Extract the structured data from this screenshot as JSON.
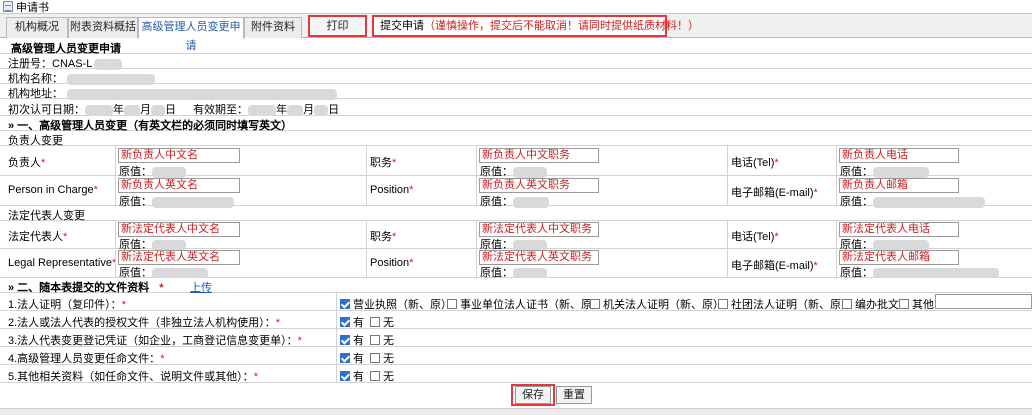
{
  "window": {
    "title": "申请书"
  },
  "tabs": [
    {
      "label": "机构概况"
    },
    {
      "label": "附表资料概括"
    },
    {
      "label": "高级管理人员变更申请"
    },
    {
      "label": "附件资料"
    }
  ],
  "toolbar": {
    "print_label": "打印",
    "submit_label": "提交申请",
    "submit_warning": "（谨慎操作，提交后不能取消！请同时提供纸质材料！）"
  },
  "form": {
    "title": "高级管理人员变更申请",
    "reg_no_label": "注册号：",
    "reg_no_value": "CNAS-L",
    "org_name_label": "机构名称：",
    "org_addr_label": "机构地址：",
    "first_date_label": "初次认可日期：",
    "valid_until_label": "有效期至：",
    "year": "年",
    "month": "月",
    "day": "日",
    "section1_title": "» 一、高级管理人员变更（有英文栏的必须同时填写英文）",
    "owner_change_label": "负责人变更",
    "legal_change_label": "法定代表人变更",
    "original_prefix": "原值：",
    "rows": [
      {
        "l1": "负责人",
        "p1": "新负责人中文名",
        "l2": "职务",
        "p2": "新负责人中文职务",
        "l3": "电话(Tel)",
        "p3": "新负责人电话"
      },
      {
        "l1": "Person in Charge",
        "p1": "新负责人英文名",
        "l2": "Position",
        "p2": "新负责人英文职务",
        "l3": "电子邮箱(E-mail)",
        "p3": "新负责人邮箱"
      },
      {
        "l1": "法定代表人",
        "p1": "新法定代表人中文名",
        "l2": "职务",
        "p2": "新法定代表人中文职务",
        "l3": "电话(Tel)",
        "p3": "新法定代表人电话"
      },
      {
        "l1": "Legal Representative",
        "p1": "新法定代表人英文名",
        "l2": "Position",
        "p2": "新法定代表人英文职务",
        "l3": "电子邮箱(E-mail)",
        "p3": "新法定代表人邮箱"
      }
    ],
    "section2_title": "» 二、随本表提交的文件资料",
    "upload_label": "上传",
    "docs": [
      {
        "label": "1.法人证明（复印件）："
      },
      {
        "label": "2.法人或法人代表的授权文件（非独立法人机构使用）："
      },
      {
        "label": "3.法人代表变更登记凭证（如企业，工商登记信息变更单）："
      },
      {
        "label": "4.高级管理人员变更任命文件："
      },
      {
        "label": "5.其他相关资料（如任命文件、说明文件或其他）："
      }
    ],
    "doc1_options": [
      "营业执照（新、原）",
      "事业单位法人证书（新、原）",
      "机关法人证明（新、原）",
      "社团法人证明（新、原）",
      "编办批文",
      "其他"
    ],
    "yes_label": "有",
    "no_label": "无",
    "required_mark": "*",
    "save_label": "保存",
    "reset_label": "重置"
  },
  "colors": {
    "accent_red": "#e0393c",
    "required_red": "#d11d1d",
    "link_blue": "#1a55b8",
    "check_blue": "#2c6fd6"
  }
}
